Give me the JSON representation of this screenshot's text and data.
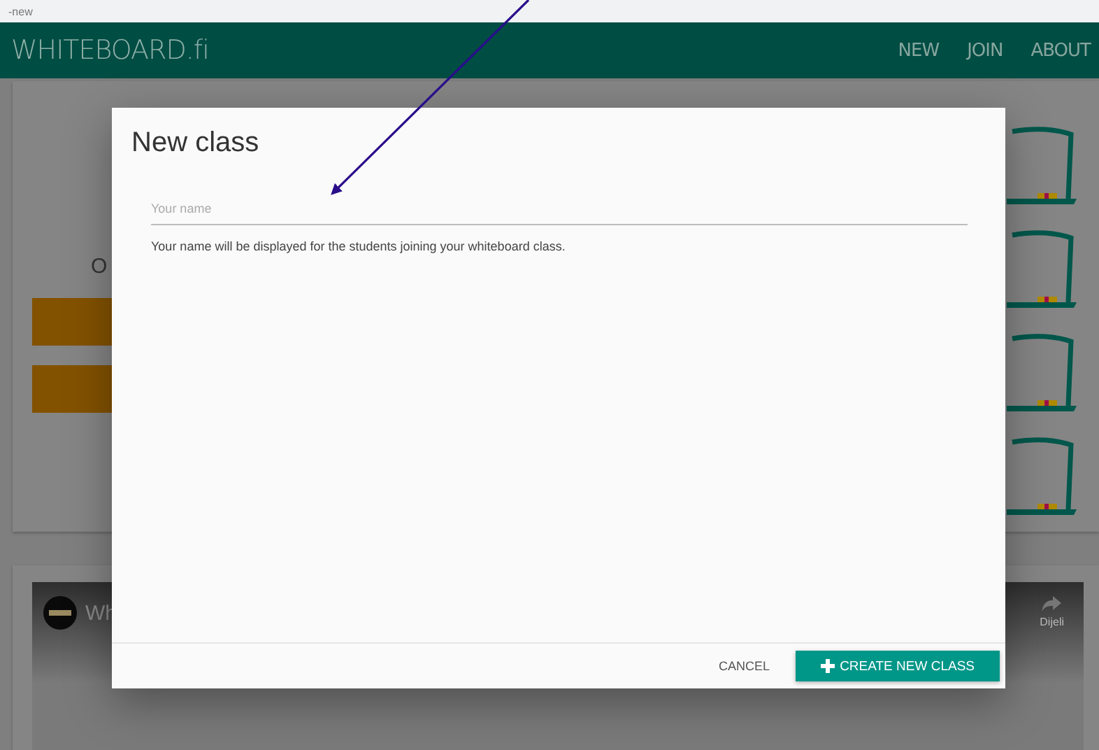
{
  "address_bar": {
    "text": "-new"
  },
  "header": {
    "logo": "WHITEBOARD.fi",
    "nav": [
      "NEW",
      "JOIN",
      "ABOUT"
    ]
  },
  "background": {
    "intro_fragment": "O",
    "video": {
      "title_fragment": "Wh",
      "share_label": "Dijeli"
    }
  },
  "dialog": {
    "title": "New class",
    "name_field": {
      "placeholder": "Your name"
    },
    "helper": "Your name will be displayed for the students joining your whiteboard class.",
    "buttons": [
      {
        "kind": "text",
        "label": "CANCEL"
      },
      {
        "kind": "primary",
        "label": "CREATE NEW CLASS"
      }
    ]
  }
}
